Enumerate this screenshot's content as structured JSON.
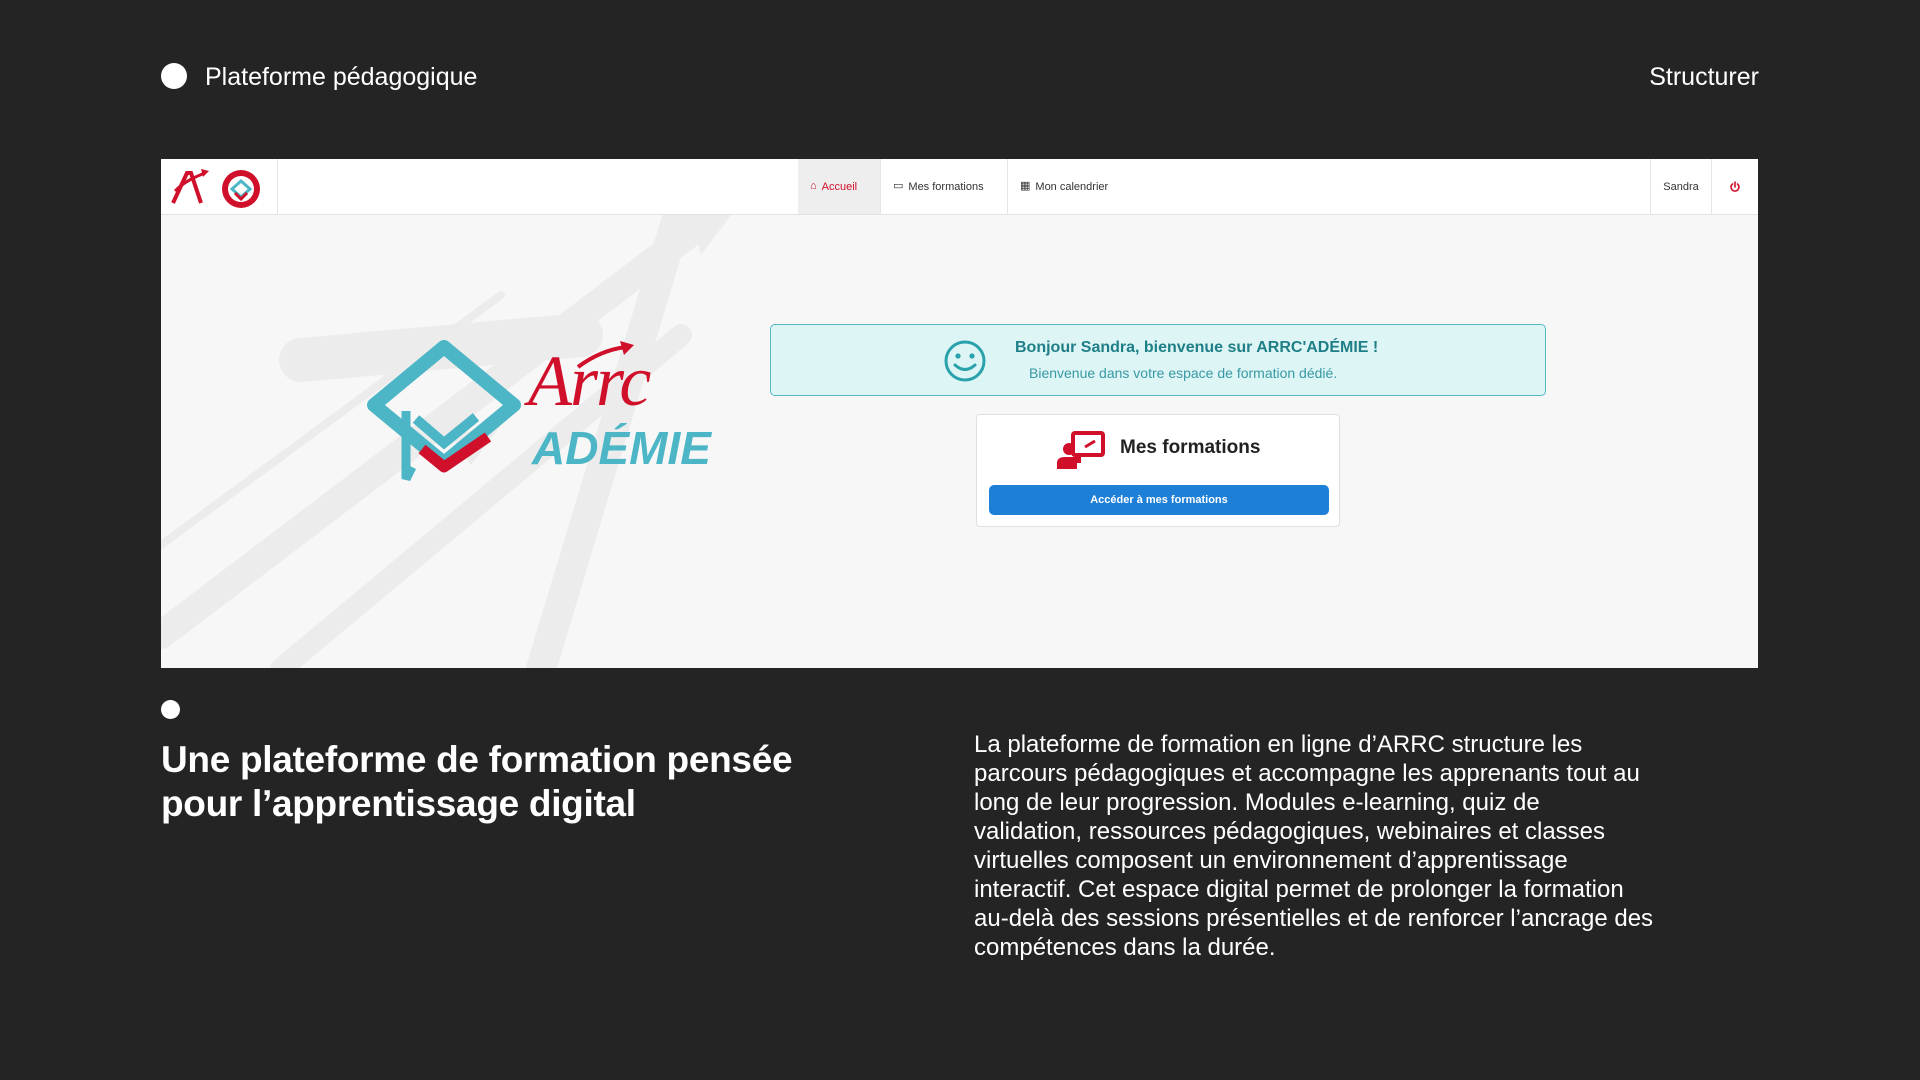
{
  "slide": {
    "header_title": "Plateforme pédagogique",
    "header_right": "Structurer",
    "bottom_title_line1": "Une plateforme de formation pensée",
    "bottom_title_line2": "pour l’apprentissage digital",
    "bottom_text": "La plateforme de formation en ligne d’ARRC structure les parcours pédagogiques et accompagne les apprenants tout au long de leur progression. Modules e-learning, quiz de validation, ressources pédagogiques, webinaires et classes virtuelles composent un environnement d’apprentissage interactif. Cet espace digital permet de prolonger la formation au-delà des sessions présentielles et de renforcer l’ancrage des compétences dans la durée."
  },
  "app": {
    "nav": {
      "items": [
        {
          "label": "Accueil",
          "icon": "home-icon",
          "active": true
        },
        {
          "label": "Mes formations",
          "icon": "training-icon",
          "active": false
        },
        {
          "label": "Mon calendrier",
          "icon": "calendar-icon",
          "active": false
        }
      ],
      "user": "Sandra",
      "power_icon": "power-icon"
    },
    "logo": {
      "word_top": "Arrc",
      "word_bottom": "ADÉMIE"
    },
    "welcome": {
      "title": "Bonjour Sandra, bienvenue sur ARRC'ADÉMIE !",
      "subtitle": "Bienvenue dans votre espace de formation dédié."
    },
    "card": {
      "title": "Mes formations",
      "button": "Accéder à mes formations"
    }
  },
  "colors": {
    "background": "#242424",
    "brand_red": "#d0102a",
    "brand_teal": "#4db6c6",
    "button_blue": "#1d7fd6",
    "welcome_bg": "#def5f6"
  }
}
